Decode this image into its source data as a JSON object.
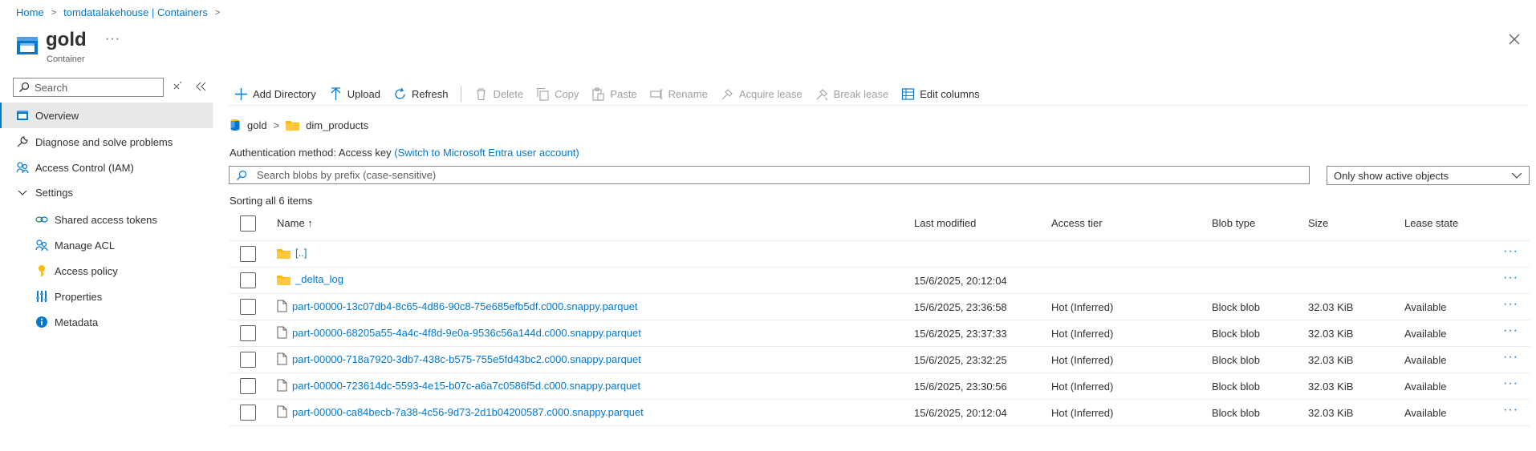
{
  "breadcrumb": [
    "Home",
    "tomdatalakehouse | Containers"
  ],
  "header": {
    "title": "gold",
    "subtitle": "Container",
    "more": "···"
  },
  "sidebar": {
    "search_placeholder": "Search",
    "items": [
      {
        "label": "Overview",
        "icon": "overview-icon",
        "active": true
      },
      {
        "label": "Diagnose and solve problems",
        "icon": "wrench-icon"
      },
      {
        "label": "Access Control (IAM)",
        "icon": "people-icon"
      },
      {
        "label": "Settings",
        "icon": "chevron-down-icon"
      },
      {
        "label": "Shared access tokens",
        "icon": "link-icon"
      },
      {
        "label": "Manage ACL",
        "icon": "people-icon"
      },
      {
        "label": "Access policy",
        "icon": "key-icon"
      },
      {
        "label": "Properties",
        "icon": "properties-icon"
      },
      {
        "label": "Metadata",
        "icon": "info-icon"
      }
    ]
  },
  "toolbar": {
    "add_directory": "Add Directory",
    "upload": "Upload",
    "refresh": "Refresh",
    "delete": "Delete",
    "copy": "Copy",
    "paste": "Paste",
    "rename": "Rename",
    "acquire_lease": "Acquire lease",
    "break_lease": "Break lease",
    "edit_columns": "Edit columns"
  },
  "path": {
    "container": "gold",
    "folder": "dim_products"
  },
  "auth": {
    "label": "Authentication method:",
    "method": "Access key",
    "switch_link": "(Switch to Microsoft Entra user account)"
  },
  "blob_search": {
    "placeholder": "Search blobs by prefix (case-sensitive)"
  },
  "filter": {
    "selected": "Only show active objects"
  },
  "sorting": "Sorting all 6 items",
  "colors": {
    "accent": "#0078d4",
    "folder": "#ffb900",
    "text": "#323130"
  },
  "table": {
    "columns": {
      "name": "Name ↑",
      "last_modified": "Last modified",
      "access_tier": "Access tier",
      "blob_type": "Blob type",
      "size": "Size",
      "lease_state": "Lease state"
    },
    "rows": [
      {
        "name": "[..]",
        "type": "folder",
        "modified": "",
        "tier": "",
        "blob_type": "",
        "size": "",
        "lease": "",
        "menu": "···"
      },
      {
        "name": "_delta_log",
        "type": "folder",
        "modified": "15/6/2025, 20:12:04",
        "tier": "",
        "blob_type": "",
        "size": "",
        "lease": "",
        "menu": "···"
      },
      {
        "name": "part-00000-13c07db4-8c65-4d86-90c8-75e685efb5df.c000.snappy.parquet",
        "type": "file",
        "modified": "15/6/2025, 23:36:58",
        "tier": "Hot (Inferred)",
        "blob_type": "Block blob",
        "size": "32.03 KiB",
        "lease": "Available",
        "menu": "···"
      },
      {
        "name": "part-00000-68205a55-4a4c-4f8d-9e0a-9536c56a144d.c000.snappy.parquet",
        "type": "file",
        "modified": "15/6/2025, 23:37:33",
        "tier": "Hot (Inferred)",
        "blob_type": "Block blob",
        "size": "32.03 KiB",
        "lease": "Available",
        "menu": "···"
      },
      {
        "name": "part-00000-718a7920-3db7-438c-b575-755e5fd43bc2.c000.snappy.parquet",
        "type": "file",
        "modified": "15/6/2025, 23:32:25",
        "tier": "Hot (Inferred)",
        "blob_type": "Block blob",
        "size": "32.03 KiB",
        "lease": "Available",
        "menu": "···"
      },
      {
        "name": "part-00000-723614dc-5593-4e15-b07c-a6a7c0586f5d.c000.snappy.parquet",
        "type": "file",
        "modified": "15/6/2025, 23:30:56",
        "tier": "Hot (Inferred)",
        "blob_type": "Block blob",
        "size": "32.03 KiB",
        "lease": "Available",
        "menu": "···"
      },
      {
        "name": "part-00000-ca84becb-7a38-4c56-9d73-2d1b04200587.c000.snappy.parquet",
        "type": "file",
        "modified": "15/6/2025, 20:12:04",
        "tier": "Hot (Inferred)",
        "blob_type": "Block blob",
        "size": "32.03 KiB",
        "lease": "Available",
        "menu": "···"
      }
    ]
  }
}
